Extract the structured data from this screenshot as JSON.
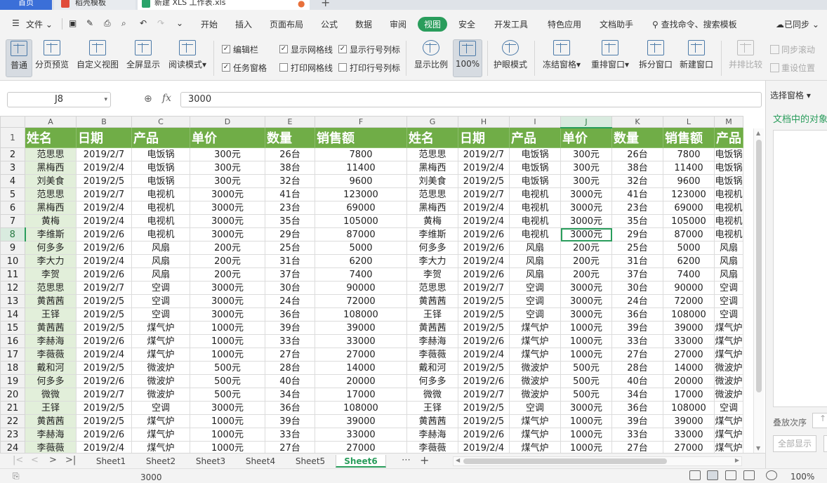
{
  "tabs": {
    "home": "首页",
    "template": "稻壳模板",
    "file": "新建 XLS 工作表.xls",
    "add": "+"
  },
  "menu": {
    "file_label": "文件",
    "items": [
      "开始",
      "插入",
      "页面布局",
      "公式",
      "数据",
      "审阅",
      "视图",
      "安全",
      "开发工具",
      "特色应用",
      "文档助手"
    ],
    "active": "视图",
    "search": "查找命令、搜索模板",
    "sync": "已同步"
  },
  "ribbon": {
    "normal": "普通",
    "page_break": "分页预览",
    "custom_view": "自定义视图",
    "fullscreen": "全屏显示",
    "reading": "阅读模式",
    "edit_bar": "编辑栏",
    "task_pane": "任务窗格",
    "show_gridlines": "显示网格线",
    "print_gridlines": "打印网格线",
    "show_headers": "显示行号列标",
    "print_headers": "打印行号列标",
    "zoom_ratio": "显示比例",
    "zoom_100": "100%",
    "eye_mode": "护眼模式",
    "freeze": "冻结窗格",
    "arrange": "重排窗口",
    "split": "拆分窗口",
    "new_window": "新建窗口",
    "side_by_side": "并排比较",
    "sync_scroll": "同步滚动",
    "reset_pos": "重设位置"
  },
  "formula": {
    "cell_ref": "J8",
    "fx": "fx",
    "value": "3000"
  },
  "columns": [
    "A",
    "B",
    "C",
    "D",
    "E",
    "F",
    "G",
    "H",
    "I",
    "J",
    "K",
    "L",
    "M"
  ],
  "selected_col": "J",
  "selected_row": "8",
  "headers": [
    "姓名",
    "日期",
    "产品",
    "单价",
    "数量",
    "销售额",
    "姓名",
    "日期",
    "产品",
    "单价",
    "数量",
    "销售额",
    "产品"
  ],
  "rows": [
    [
      "范思思",
      "2019/2/7",
      "电饭锅",
      "300元",
      "26台",
      "7800",
      "范思思",
      "2019/2/7",
      "电饭锅",
      "300元",
      "26台",
      "7800",
      "电饭锅"
    ],
    [
      "黑梅西",
      "2019/2/4",
      "电饭锅",
      "300元",
      "38台",
      "11400",
      "黑梅西",
      "2019/2/4",
      "电饭锅",
      "300元",
      "38台",
      "11400",
      "电饭锅"
    ],
    [
      "刘美食",
      "2019/2/5",
      "电饭锅",
      "300元",
      "32台",
      "9600",
      "刘美食",
      "2019/2/5",
      "电饭锅",
      "300元",
      "32台",
      "9600",
      "电饭锅"
    ],
    [
      "范思思",
      "2019/2/7",
      "电视机",
      "3000元",
      "41台",
      "123000",
      "范思思",
      "2019/2/7",
      "电视机",
      "3000元",
      "41台",
      "123000",
      "电视机"
    ],
    [
      "黑梅西",
      "2019/2/4",
      "电视机",
      "3000元",
      "23台",
      "69000",
      "黑梅西",
      "2019/2/4",
      "电视机",
      "3000元",
      "23台",
      "69000",
      "电视机"
    ],
    [
      "黄梅",
      "2019/2/4",
      "电视机",
      "3000元",
      "35台",
      "105000",
      "黄梅",
      "2019/2/4",
      "电视机",
      "3000元",
      "35台",
      "105000",
      "电视机"
    ],
    [
      "李维斯",
      "2019/2/6",
      "电视机",
      "3000元",
      "29台",
      "87000",
      "李维斯",
      "2019/2/6",
      "电视机",
      "3000元",
      "29台",
      "87000",
      "电视机"
    ],
    [
      "何多多",
      "2019/2/6",
      "风扇",
      "200元",
      "25台",
      "5000",
      "何多多",
      "2019/2/6",
      "风扇",
      "200元",
      "25台",
      "5000",
      "风扇"
    ],
    [
      "李大力",
      "2019/2/4",
      "风扇",
      "200元",
      "31台",
      "6200",
      "李大力",
      "2019/2/4",
      "风扇",
      "200元",
      "31台",
      "6200",
      "风扇"
    ],
    [
      "李贺",
      "2019/2/6",
      "风扇",
      "200元",
      "37台",
      "7400",
      "李贺",
      "2019/2/6",
      "风扇",
      "200元",
      "37台",
      "7400",
      "风扇"
    ],
    [
      "范思思",
      "2019/2/7",
      "空调",
      "3000元",
      "30台",
      "90000",
      "范思思",
      "2019/2/7",
      "空调",
      "3000元",
      "30台",
      "90000",
      "空调"
    ],
    [
      "黄茜茜",
      "2019/2/5",
      "空调",
      "3000元",
      "24台",
      "72000",
      "黄茜茜",
      "2019/2/5",
      "空调",
      "3000元",
      "24台",
      "72000",
      "空调"
    ],
    [
      "王铎",
      "2019/2/5",
      "空调",
      "3000元",
      "36台",
      "108000",
      "王铎",
      "2019/2/5",
      "空调",
      "3000元",
      "36台",
      "108000",
      "空调"
    ],
    [
      "黄茜茜",
      "2019/2/5",
      "煤气炉",
      "1000元",
      "39台",
      "39000",
      "黄茜茜",
      "2019/2/5",
      "煤气炉",
      "1000元",
      "39台",
      "39000",
      "煤气炉"
    ],
    [
      "李赫海",
      "2019/2/6",
      "煤气炉",
      "1000元",
      "33台",
      "33000",
      "李赫海",
      "2019/2/6",
      "煤气炉",
      "1000元",
      "33台",
      "33000",
      "煤气炉"
    ],
    [
      "李薇薇",
      "2019/2/4",
      "煤气炉",
      "1000元",
      "27台",
      "27000",
      "李薇薇",
      "2019/2/4",
      "煤气炉",
      "1000元",
      "27台",
      "27000",
      "煤气炉"
    ],
    [
      "戴和河",
      "2019/2/5",
      "微波炉",
      "500元",
      "28台",
      "14000",
      "戴和河",
      "2019/2/5",
      "微波炉",
      "500元",
      "28台",
      "14000",
      "微波炉"
    ],
    [
      "何多多",
      "2019/2/6",
      "微波炉",
      "500元",
      "40台",
      "20000",
      "何多多",
      "2019/2/6",
      "微波炉",
      "500元",
      "40台",
      "20000",
      "微波炉"
    ],
    [
      "微微",
      "2019/2/7",
      "微波炉",
      "500元",
      "34台",
      "17000",
      "微微",
      "2019/2/7",
      "微波炉",
      "500元",
      "34台",
      "17000",
      "微波炉"
    ],
    [
      "王铎",
      "2019/2/5",
      "空调",
      "3000元",
      "36台",
      "108000",
      "王铎",
      "2019/2/5",
      "空调",
      "3000元",
      "36台",
      "108000",
      "空调"
    ],
    [
      "黄茜茜",
      "2019/2/5",
      "煤气炉",
      "1000元",
      "39台",
      "39000",
      "黄茜茜",
      "2019/2/5",
      "煤气炉",
      "1000元",
      "39台",
      "39000",
      "煤气炉"
    ],
    [
      "李赫海",
      "2019/2/6",
      "煤气炉",
      "1000元",
      "33台",
      "33000",
      "李赫海",
      "2019/2/6",
      "煤气炉",
      "1000元",
      "33台",
      "33000",
      "煤气炉"
    ],
    [
      "李薇薇",
      "2019/2/4",
      "煤气炉",
      "1000元",
      "27台",
      "27000",
      "李薇薇",
      "2019/2/4",
      "煤气炉",
      "1000元",
      "27台",
      "27000",
      "煤气炉"
    ]
  ],
  "sheets": [
    "Sheet1",
    "Sheet2",
    "Sheet3",
    "Sheet4",
    "Sheet5",
    "Sheet6"
  ],
  "active_sheet": "Sheet6",
  "status": {
    "value": "3000",
    "zoom": "100%"
  },
  "pane": {
    "title": "选择窗格",
    "subtitle": "文档中的对象",
    "order": "叠放次序",
    "show_all": "全部显示"
  },
  "colors": {
    "accent": "#2a9d5c",
    "header_fill": "#70ad47",
    "name_fill": "#e2efda",
    "home_tab": "#3b6fd8"
  }
}
